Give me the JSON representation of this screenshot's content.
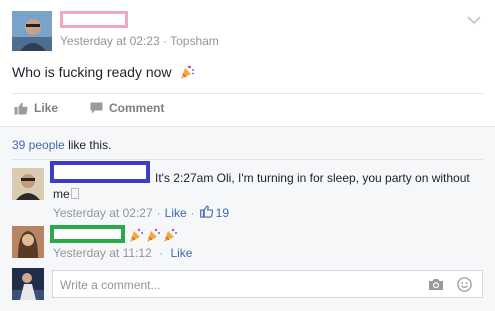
{
  "post": {
    "meta_time": "Yesterday at 02:23",
    "meta_sep": "·",
    "meta_location": "Topsham",
    "text": "Who is fucking ready now"
  },
  "actions": {
    "like_label": "Like",
    "comment_label": "Comment"
  },
  "likes_summary": {
    "count_link": "39 people",
    "suffix": "like this."
  },
  "comments": [
    {
      "text_line1": "It's 2:27am Oli, I'm turning in for sleep, you party on without",
      "text_line2": "me",
      "time": "Yesterday at 02:27",
      "sep": "·",
      "like_link": "Like",
      "sep2": "·",
      "like_count": "19"
    },
    {
      "time": "Yesterday at 11:12",
      "sep": "·",
      "like_link": "Like"
    }
  ],
  "composer": {
    "placeholder": "Write a comment..."
  },
  "icons": {
    "chevron": "chevron-down-icon",
    "like": "thumbs-up-icon",
    "comment": "speech-bubble-icon",
    "camera": "camera-icon",
    "smiley": "smiley-icon",
    "party": "party-popper-icon"
  },
  "colors": {
    "link": "#4267b2",
    "meta": "#90949c",
    "redact_pink": "#f0a6c3",
    "redact_blue": "#3b3bc4",
    "redact_green": "#2aa84a"
  }
}
